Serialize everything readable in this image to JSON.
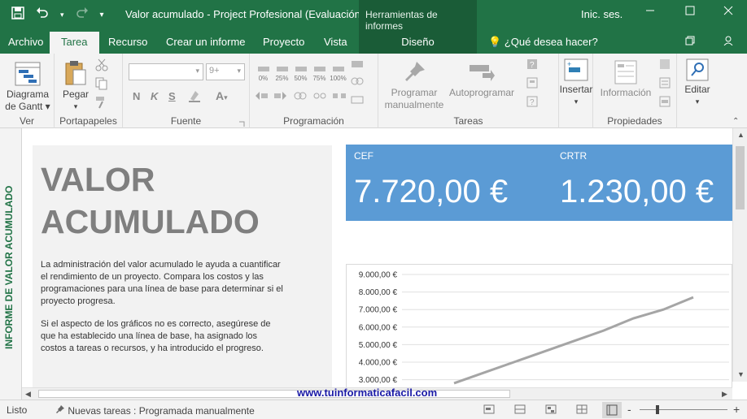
{
  "titlebar": {
    "title": "Valor acumulado  -  Project Profesional (Evaluación)",
    "tools_label": "Herramientas de informes",
    "signin": "Inic. ses.",
    "qat_dropdown": "▾"
  },
  "tabs": [
    {
      "label": "Archivo"
    },
    {
      "label": "Tarea"
    },
    {
      "label": "Recurso"
    },
    {
      "label": "Crear un informe"
    },
    {
      "label": "Proyecto"
    },
    {
      "label": "Vista"
    }
  ],
  "design_tab": "Diseño",
  "tell_me": "¿Qué desea hacer?",
  "ribbon": {
    "ver": {
      "button": "Diagrama de Gantt",
      "line1": "Diagrama",
      "line2": "de Gantt",
      "label": "Ver"
    },
    "portapapeles": {
      "paste": "Pegar",
      "label": "Portapapeles"
    },
    "fuente": {
      "size": "9+",
      "bold": "N",
      "italic": "K",
      "underline": "S",
      "label": "Fuente"
    },
    "programacion": {
      "pct": [
        "0%",
        "25%",
        "50%",
        "75%",
        "100%"
      ],
      "label": "Programación"
    },
    "tareas": {
      "manual_line1": "Programar",
      "manual_line2": "manualmente",
      "auto": "Autoprogramar",
      "label": "Tareas"
    },
    "insertar": {
      "label": "Insertar"
    },
    "propiedades": {
      "info": "Información",
      "label": "Propiedades"
    },
    "editar": {
      "label": "Editar"
    }
  },
  "sidebar_label": "INFORME DE VALOR ACUMULADO",
  "report": {
    "title_line1": "VALOR",
    "title_line2": "ACUMULADO",
    "para1": "La administración del valor acumulado le ayuda a cuantificar el rendimiento de un proyecto. Compara los costos y las programaciones para una línea de base para determinar si el proyecto progresa.",
    "para2": "Si el aspecto de los gráficos no es correcto, asegúrese de que ha establecido una línea de base, ha asignado los costos a tareas o recursos, y ha introducido el progreso."
  },
  "metrics": {
    "cef_label": "CEF",
    "cef_value": "7.720,00 €",
    "crtr_label": "CRTR",
    "crtr_value": "1.230,00 €"
  },
  "chart_data": {
    "type": "line",
    "title": "",
    "xlabel": "",
    "ylabel": "",
    "y_ticks": [
      "3.000,00 €",
      "4.000,00 €",
      "5.000,00 €",
      "6.000,00 €",
      "7.000,00 €",
      "8.000,00 €",
      "9.000,00 €"
    ],
    "ylim": [
      3000,
      9000
    ],
    "grid": true,
    "series": [
      {
        "values": [
          2800,
          3400,
          4000,
          4600,
          5200,
          5800,
          6500,
          7000,
          7700
        ],
        "color": "#a5a5a5"
      }
    ],
    "x": [
      0,
      1,
      2,
      3,
      4,
      5,
      6,
      7,
      8
    ]
  },
  "watermark": "www.tuinformaticafacil.com",
  "status": {
    "listo": "Listo",
    "new_tasks": "Nuevas tareas : Programada manualmente",
    "zoom_minus": "-",
    "zoom_plus": "+"
  },
  "colors": {
    "accent": "#217346",
    "metric_bg": "#5b9bd5",
    "line": "#a5a5a5"
  }
}
